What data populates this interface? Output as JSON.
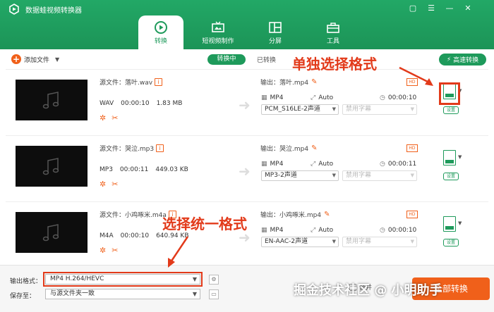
{
  "window": {
    "title": "数据蛙视频转换器",
    "controls": [
      "▢",
      "☰",
      "—",
      "✕"
    ]
  },
  "nav": {
    "tabs": [
      {
        "label": "转换",
        "icon": "convert-icon",
        "active": true
      },
      {
        "label": "短视频制作",
        "icon": "tv-icon",
        "active": false
      },
      {
        "label": "分屏",
        "icon": "split-screen-icon",
        "active": false
      },
      {
        "label": "工具",
        "icon": "toolbox-icon",
        "active": false
      }
    ]
  },
  "toolbar": {
    "add_file": "添加文件",
    "converting": "转换中",
    "converted": "已转换",
    "fast_convert": "高速转换"
  },
  "files": [
    {
      "source_name": "源文件：落叶.wav",
      "format": "WAV",
      "duration": "00:00:10",
      "size": "1.83 MB",
      "output_name": "输出：落叶.mp4",
      "out_format": "MP4",
      "out_res": "Auto",
      "out_duration": "00:00:10",
      "audio_track": "PCM_S16LE-2声道",
      "subtitle": "禁用字幕",
      "settings": "设置"
    },
    {
      "source_name": "源文件：哭泣.mp3",
      "format": "MP3",
      "duration": "00:00:11",
      "size": "449.03 KB",
      "output_name": "输出：哭泣.mp4",
      "out_format": "MP4",
      "out_res": "Auto",
      "out_duration": "00:00:11",
      "audio_track": "MP3-2声道",
      "subtitle": "禁用字幕",
      "settings": "设置"
    },
    {
      "source_name": "源文件：小鸡啄米.m4a",
      "format": "M4A",
      "duration": "00:00:10",
      "size": "640.94 KB",
      "output_name": "输出：小鸡啄米.mp4",
      "out_format": "MP4",
      "out_res": "Auto",
      "out_duration": "00:00:10",
      "audio_track": "EN-AAC-2声道",
      "subtitle": "禁用字幕",
      "settings": "设置"
    }
  ],
  "bottom": {
    "output_format_label": "输出格式：",
    "output_format_value": "MP4 H.264/HEVC",
    "save_to_label": "保存至：",
    "save_to_value": "与源文件夹一致",
    "merge_label": "合并",
    "convert_button": "全部转换"
  },
  "annotations": {
    "single_format": "单独选择格式",
    "unified_format": "选择统一格式"
  },
  "watermark": "掘金技术社区 @ 小明助手",
  "colors": {
    "brand_green": "#1e9a5b",
    "accent_orange": "#f0601a",
    "annotation_red": "#e23a1a"
  }
}
